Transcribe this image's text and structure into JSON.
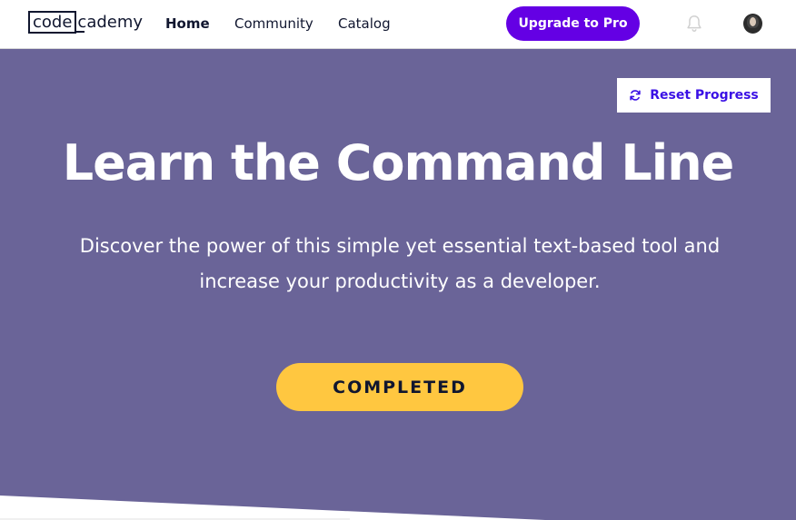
{
  "header": {
    "logo": {
      "boxed": "code",
      "rest": "cademy"
    },
    "nav": [
      {
        "label": "Home",
        "active": true
      },
      {
        "label": "Community",
        "active": false
      },
      {
        "label": "Catalog",
        "active": false
      }
    ],
    "upgrade_label": "Upgrade to Pro",
    "icons": {
      "notifications": "bell-icon",
      "profile": "avatar"
    }
  },
  "hero": {
    "reset_label": "Reset Progress",
    "reset_icon": "refresh-icon",
    "title": "Learn the Command Line",
    "subtitle_line1": "Discover the power of this simple yet essential text-based tool and",
    "subtitle_line2": "increase your productivity as a developer.",
    "status_label": "COMPLETED"
  },
  "colors": {
    "hero_bg": "#6a6498",
    "upgrade_bg": "#6400e4",
    "reset_text": "#3a10e5",
    "completed_bg": "#ffc740",
    "navy": "#10162f"
  }
}
